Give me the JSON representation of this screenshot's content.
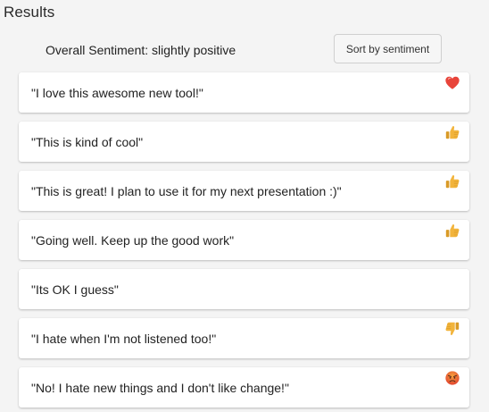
{
  "header": {
    "title": "Results"
  },
  "summary": {
    "overall_label": "Overall Sentiment: slightly positive",
    "sort_button_label": "Sort by sentiment"
  },
  "results": [
    {
      "text": "\"I love this awesome new tool!\"",
      "icon": "heart-icon"
    },
    {
      "text": "\"This is kind of cool\"",
      "icon": "thumbs-up-icon"
    },
    {
      "text": "\"This is great! I plan to use it for my next presentation :)\"",
      "icon": "thumbs-up-icon"
    },
    {
      "text": "\"Going well. Keep up the good work\"",
      "icon": "thumbs-up-icon"
    },
    {
      "text": "\"Its OK I guess\"",
      "icon": ""
    },
    {
      "text": "\"I hate when I'm not listened too!\"",
      "icon": "thumbs-down-icon"
    },
    {
      "text": "\"No! I hate new things and I don't like change!\"",
      "icon": "angry-face-icon"
    }
  ],
  "colors": {
    "heart": "#e8443a",
    "thumb": "#f2b43c",
    "angry_face": "#e8663a"
  }
}
